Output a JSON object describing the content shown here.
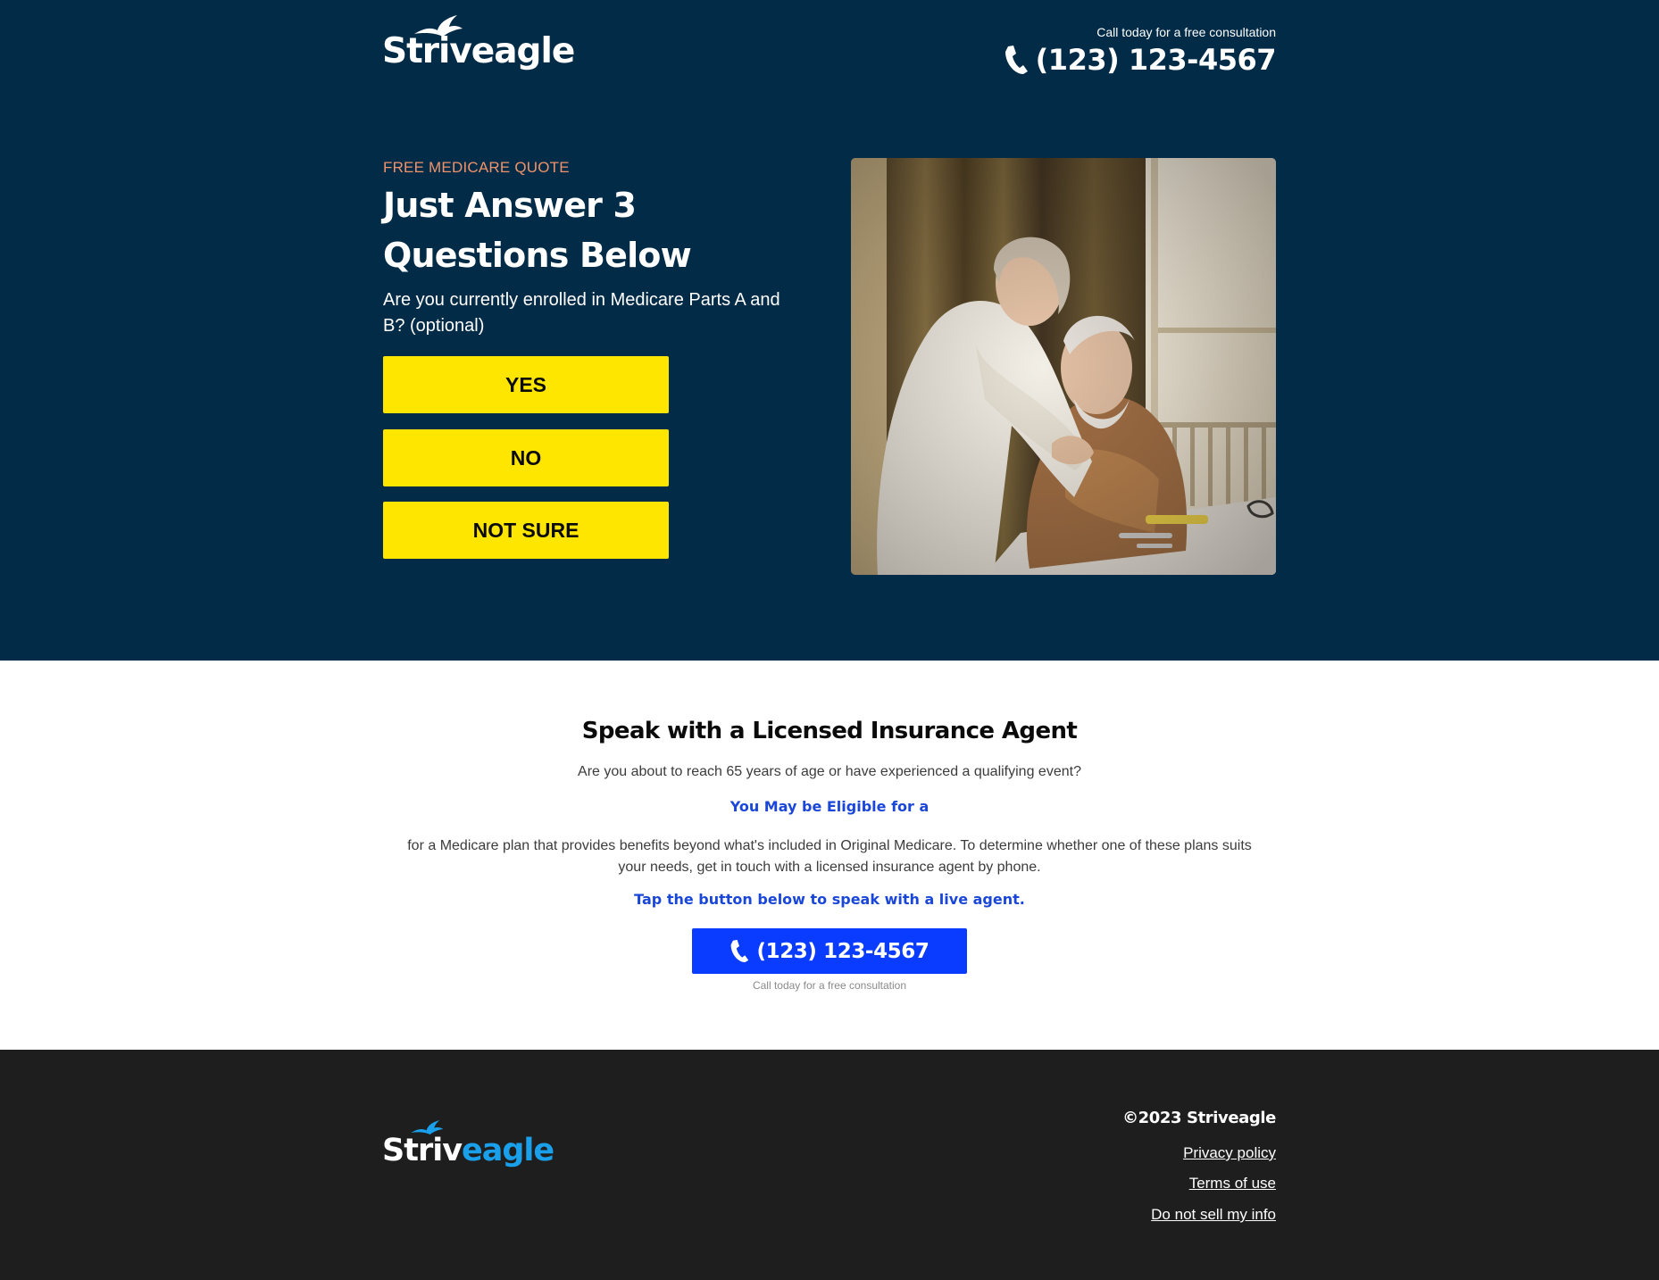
{
  "brand": {
    "name_part1": "Striv",
    "name_part2": "eagle",
    "colors": {
      "hero_bg": "#022b47",
      "cta_yellow": "#ffe600",
      "cta_blue": "#0a3cff",
      "link_blue": "#1a47d8",
      "eyebrow_orange": "#f0936a",
      "footer_bg": "#1e1e1e",
      "footer_accent": "#1aa0ea"
    }
  },
  "header": {
    "call_note": "Call today for a free consultation",
    "phone": "(123) 123-4567",
    "phone_icon": "phone-icon"
  },
  "hero": {
    "eyebrow": "FREE MEDICARE QUOTE",
    "headline": "Just Answer 3 Questions Below",
    "question": "Are you currently enrolled in Medicare Parts A and B? (optional)",
    "answers": [
      "YES",
      "NO",
      "NOT SURE"
    ],
    "image_alt": "elderly-couple-embracing-photo"
  },
  "agent": {
    "title": "Speak with a Licensed Insurance Agent",
    "subtitle": "Are you about to reach 65 years of age or have experienced a qualifying event?",
    "eligible": "You May be Eligible for a",
    "body": "for a Medicare plan that provides benefits beyond what's included in Original Medicare. To determine whether one of these plans suits your needs, get in touch with a licensed insurance agent by phone.",
    "tap": "Tap the button below to speak with a live agent.",
    "phone": "(123) 123-4567",
    "cta_note": "Call today for a free consultation"
  },
  "footer": {
    "copyright": "©2023 Striveagle",
    "links": [
      "Privacy policy",
      "Terms of use",
      "Do not sell my info"
    ]
  }
}
